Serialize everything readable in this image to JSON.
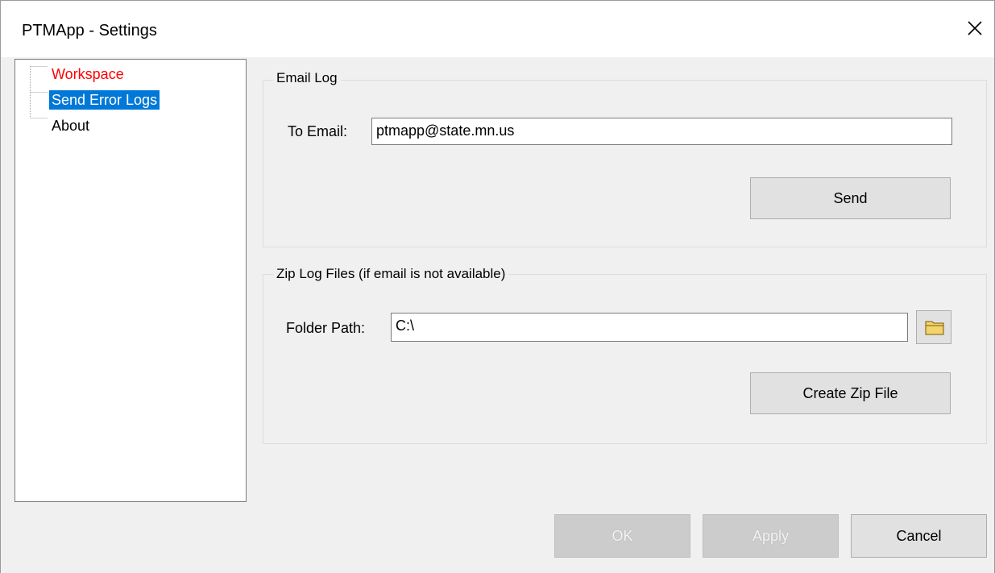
{
  "window": {
    "title": "PTMApp - Settings",
    "close_icon": "close-icon"
  },
  "tree": {
    "items": [
      {
        "label": "Workspace",
        "state": "error",
        "color": "#ff0000"
      },
      {
        "label": "Send Error Logs",
        "state": "selected",
        "color": "#ffffff",
        "highlight": "#0078d7"
      },
      {
        "label": "About",
        "state": "normal",
        "color": "#000000"
      }
    ]
  },
  "email_group": {
    "legend": "Email Log",
    "to_email_label": "To Email:",
    "to_email_value": "ptmapp@state.mn.us",
    "send_label": "Send"
  },
  "zip_group": {
    "legend": "Zip Log Files (if email is not available)",
    "folder_path_label": "Folder Path:",
    "folder_path_value": "C:\\",
    "browse_icon": "folder-icon",
    "create_zip_label": "Create Zip File"
  },
  "footer": {
    "ok_label": "OK",
    "ok_enabled": false,
    "apply_label": "Apply",
    "apply_enabled": false,
    "cancel_label": "Cancel",
    "cancel_enabled": true
  }
}
